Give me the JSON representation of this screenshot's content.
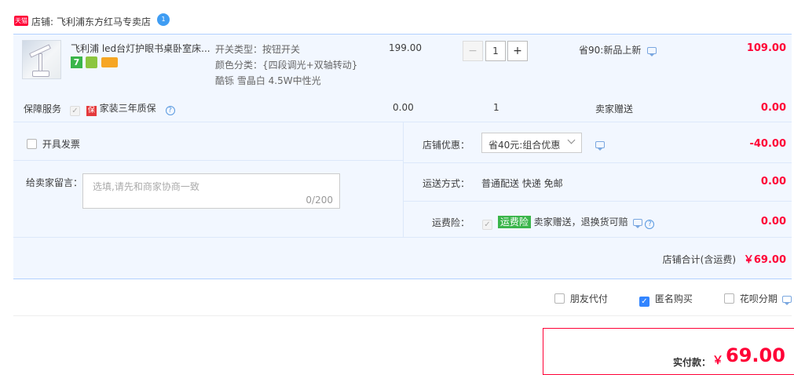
{
  "shop": {
    "badge_text": "天猫",
    "label": "店铺:",
    "name": "飞利浦东方红马专卖店",
    "badge_count": "1"
  },
  "product": {
    "title": "飞利浦 led台灯护眼书桌卧室床...",
    "sku_switch": "开关类型：按钮开关",
    "sku_color": "颜色分类：{四段调光+双轴转动}",
    "sku_color2": "酷铄 雪晶白 4.5W中性光",
    "badge_7": "7",
    "unit_price": "199.00",
    "quantity": "1",
    "decrease_label": "−",
    "increase_label": "+",
    "discount": "省90:新品上新",
    "subtotal": "109.00"
  },
  "service": {
    "label": "保障服务",
    "item_icon": "保",
    "item": "家装三年质保",
    "help": "?",
    "price": "0.00",
    "qty": "1",
    "gift": "卖家赠送",
    "subtotal": "0.00"
  },
  "invoice": {
    "label": "开具发票"
  },
  "store_discount": {
    "label": "店铺优惠：",
    "selected": "省40元:组合优惠",
    "value": "-40.00"
  },
  "message": {
    "label": "给卖家留言：",
    "placeholder": "选填,请先和商家协商一致",
    "counter": "0/200"
  },
  "shipping": {
    "label": "运送方式：",
    "value": "普通配送 快递 免邮",
    "price": "0.00"
  },
  "insurance": {
    "label": "运费险：",
    "tag": "运费险",
    "text": "卖家赠送，退换货可赔",
    "help": "?",
    "price": "0.00"
  },
  "store_total": {
    "label": "店铺合计(含运费)",
    "value": "￥69.00"
  },
  "options": {
    "friend_pay": "朋友代付",
    "anonymous": "匿名购买",
    "huabei": "花呗分期"
  },
  "payment": {
    "label": "实付款：",
    "currency": "￥",
    "value": "69.00"
  },
  "colors": {
    "accent": "#ff0036",
    "panel_bg": "#f2f7ff",
    "border": "#b2d1ff"
  }
}
